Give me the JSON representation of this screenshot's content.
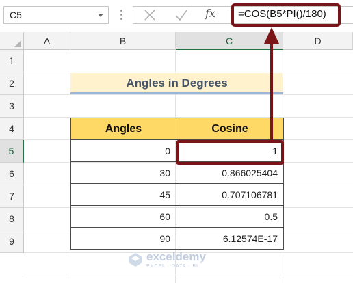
{
  "formula_bar": {
    "name_box": "C5",
    "cancel_icon": "cancel-x-icon",
    "enter_icon": "enter-check-icon",
    "fx_label": "fx",
    "formula": "=COS(B5*PI()/180)"
  },
  "columns": [
    "A",
    "B",
    "C",
    "D"
  ],
  "active_column": "C",
  "rows": [
    "1",
    "2",
    "3",
    "4",
    "5",
    "6",
    "7",
    "8",
    "9"
  ],
  "active_row": "5",
  "sheet": {
    "title": "Angles in Degrees",
    "table": {
      "headers": [
        "Angles",
        "Cosine"
      ],
      "rows": [
        [
          "0",
          "1"
        ],
        [
          "30",
          "0.866025404"
        ],
        [
          "45",
          "0.707106781"
        ],
        [
          "60",
          "0.5"
        ],
        [
          "90",
          "6.12574E-17"
        ]
      ]
    }
  },
  "colors": {
    "highlight": "#7b1416",
    "header_fill": "#ffd966",
    "title_fill": "#fff2cc",
    "active_header": "#217346"
  },
  "watermark": {
    "name": "exceldemy",
    "tagline": "EXCEL · DATA · BI"
  }
}
